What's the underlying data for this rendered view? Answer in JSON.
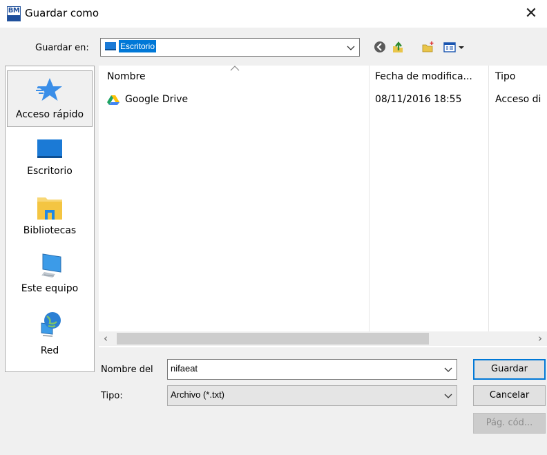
{
  "window": {
    "title": "Guardar como",
    "app_icon_text": "BM",
    "close_glyph": "✕"
  },
  "toolbar": {
    "save_in_label": "Guardar en:",
    "save_in_value": "Escritorio",
    "icons": [
      "back-icon",
      "up-folder-icon",
      "new-folder-icon",
      "view-menu-icon"
    ]
  },
  "sidebar": {
    "items": [
      {
        "label": "Acceso rápido",
        "icon": "quick-access-star-icon",
        "selected": true
      },
      {
        "label": "Escritorio",
        "icon": "desktop-icon",
        "selected": false
      },
      {
        "label": "Bibliotecas",
        "icon": "libraries-icon",
        "selected": false
      },
      {
        "label": "Este equipo",
        "icon": "computer-icon",
        "selected": false
      },
      {
        "label": "Red",
        "icon": "network-icon",
        "selected": false
      }
    ]
  },
  "filelist": {
    "columns": [
      "Nombre",
      "Fecha de modifica...",
      "Tipo"
    ],
    "rows": [
      {
        "name": "Google Drive",
        "date": "08/11/2016 18:55",
        "type": "Acceso di"
      }
    ],
    "scroll_left": "‹",
    "scroll_right": "›"
  },
  "form": {
    "filename_label": "Nombre del",
    "filename_value": "nifaeat",
    "type_label": "Tipo:",
    "type_value": "Archivo (*.txt)"
  },
  "buttons": {
    "save": "Guardar",
    "cancel": "Cancelar",
    "codepage": "Pág. cód..."
  },
  "colors": {
    "accent": "#0078d7",
    "desktop_blue": "#1b7ad6",
    "folder_yellow": "#f8d775"
  }
}
